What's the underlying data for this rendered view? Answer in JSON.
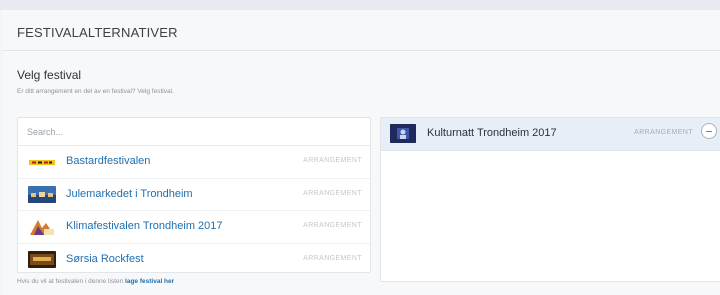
{
  "section": {
    "title": "FESTIVALALTERNATIVER"
  },
  "field": {
    "label": "Velg festival",
    "help": "Er ditt arrangement en del av en festival? Velg festival."
  },
  "search": {
    "placeholder": "Search...",
    "value": ""
  },
  "festivals": [
    {
      "name": "Bastardfestivalen",
      "type": "ARRANGEMENT",
      "icon": "bastard-logo-thumbnail"
    },
    {
      "name": "Julemarkedet i Trondheim",
      "type": "ARRANGEMENT",
      "icon": "julemarked-thumbnail"
    },
    {
      "name": "Klimafestivalen Trondheim 2017",
      "type": "ARRANGEMENT",
      "icon": "klimafestival-thumbnail"
    },
    {
      "name": "Sørsia Rockfest",
      "type": "ARRANGEMENT",
      "icon": "sorsia-thumbnail"
    }
  ],
  "footer": {
    "text": "Hvis du vil at festivalen i denne listen ",
    "link": "lage festival her"
  },
  "selected": [
    {
      "name": "Kulturnatt Trondheim 2017",
      "type": "ARRANGEMENT",
      "icon": "kulturnatt-thumbnail"
    }
  ],
  "colors": {
    "link": "#1f6fb0",
    "selected_row": "#e8eef8",
    "background": "#f3f4f7"
  }
}
